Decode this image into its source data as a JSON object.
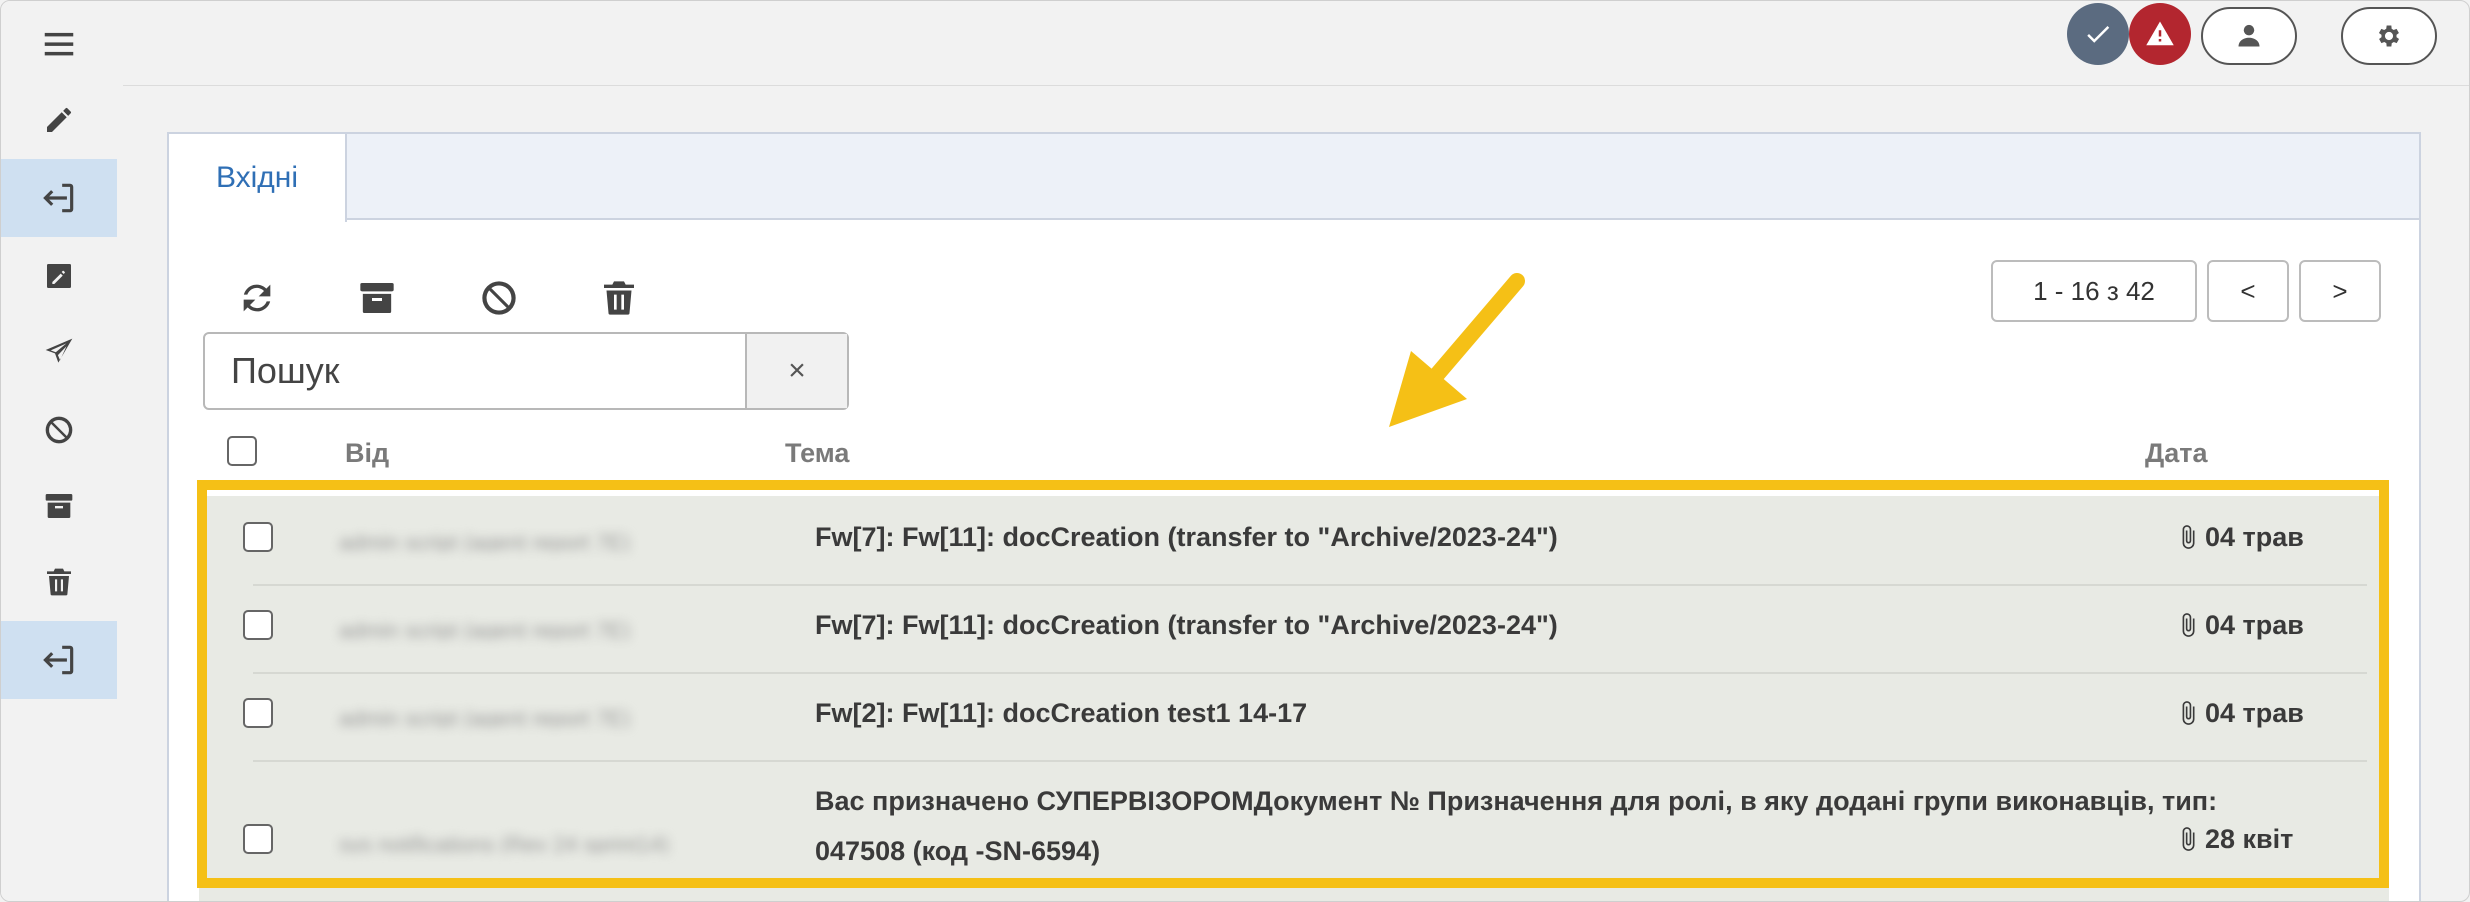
{
  "header": {
    "status_ok_icon": "check-icon",
    "status_alert_icon": "warning-icon",
    "user_icon": "user-icon",
    "settings_icon": "gear-icon",
    "colors": {
      "ok_badge": "#5b6b80",
      "alert_badge": "#b3262f"
    }
  },
  "sidebar": {
    "items": [
      {
        "icon": "menu-icon"
      },
      {
        "icon": "pencil-icon"
      },
      {
        "icon": "sign-in-icon",
        "active": true
      },
      {
        "icon": "edit-square-icon"
      },
      {
        "icon": "paper-plane-icon"
      },
      {
        "icon": "ban-icon"
      },
      {
        "icon": "archive-icon"
      },
      {
        "icon": "trash-icon"
      },
      {
        "icon": "sign-in-icon",
        "active": true
      }
    ]
  },
  "tabs": [
    {
      "label": "Вхідні",
      "active": true
    }
  ],
  "toolbar": {
    "tools": [
      "refresh-icon",
      "archive-icon",
      "ban-icon",
      "trash-icon"
    ]
  },
  "search": {
    "placeholder": "Пошук",
    "clear": "×"
  },
  "pager": {
    "range": "1 - 16 з 42",
    "prev": "<",
    "next": ">"
  },
  "table": {
    "columns": {
      "from": "Від",
      "subject": "Тема",
      "date": "Дата"
    },
    "rows": [
      {
        "from": "admin script (agent report 7E)",
        "subject": "Fw[7]: Fw[11]: docCreation (transfer to \"Archive/2023-24\")",
        "date": "04 трав",
        "attachment": true
      },
      {
        "from": "admin script (agent report 7E)",
        "subject": "Fw[7]: Fw[11]: docCreation (transfer to \"Archive/2023-24\")",
        "date": "04 трав",
        "attachment": true
      },
      {
        "from": "admin script (agent report 7E)",
        "subject": "Fw[2]: Fw[11]: docCreation test1 14-17",
        "date": "04 трав",
        "attachment": true
      },
      {
        "from": "sys notifications (Rev 24 sprint14)",
        "subject": "Вас призначено СУПЕРВІЗОРОМДокумент № Призначення для ролі, в яку додані групи виконавців, тип:",
        "subject2": "047508 (код -SN-6594)",
        "date": "28 квіт",
        "attachment": true
      }
    ]
  },
  "annotation": {
    "highlight_color": "#f5c016"
  }
}
